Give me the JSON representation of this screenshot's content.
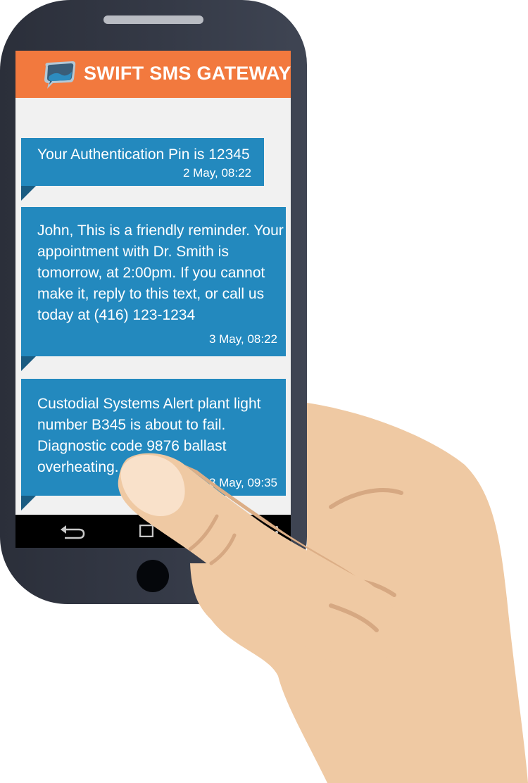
{
  "app": {
    "title": "SWIFT SMS GATEWAY",
    "logo_icon": "speech-bubble-icon"
  },
  "messages": [
    {
      "text": "Your Authentication Pin is 12345",
      "time": "2 May, 08:22"
    },
    {
      "text": "John, This is a friendly reminder. Your\nappointment with Dr. Smith is\ntomorrow, at 2:00pm. If you cannot\nmake it, reply to this text, or call us\ntoday at (416) 123-1234",
      "time": "3 May, 08:22"
    },
    {
      "text": "Custodial Systems Alert plant light\nnumber B345 is about to fail.\nDiagnostic code 9876 ballast\noverheating.",
      "time": "3 May, 09:35"
    }
  ],
  "navbar": {
    "back_icon": "back-arrow-icon",
    "home_icon": "home-icon",
    "menu_icon": "overflow-menu-icon"
  },
  "colors": {
    "header": "#f2793e",
    "bubble": "#2389be",
    "bubble_tail": "#1a5c82",
    "screen_bg": "#f1f1f1",
    "phone_body": "#2f3440",
    "skin": "#efc9a3"
  }
}
